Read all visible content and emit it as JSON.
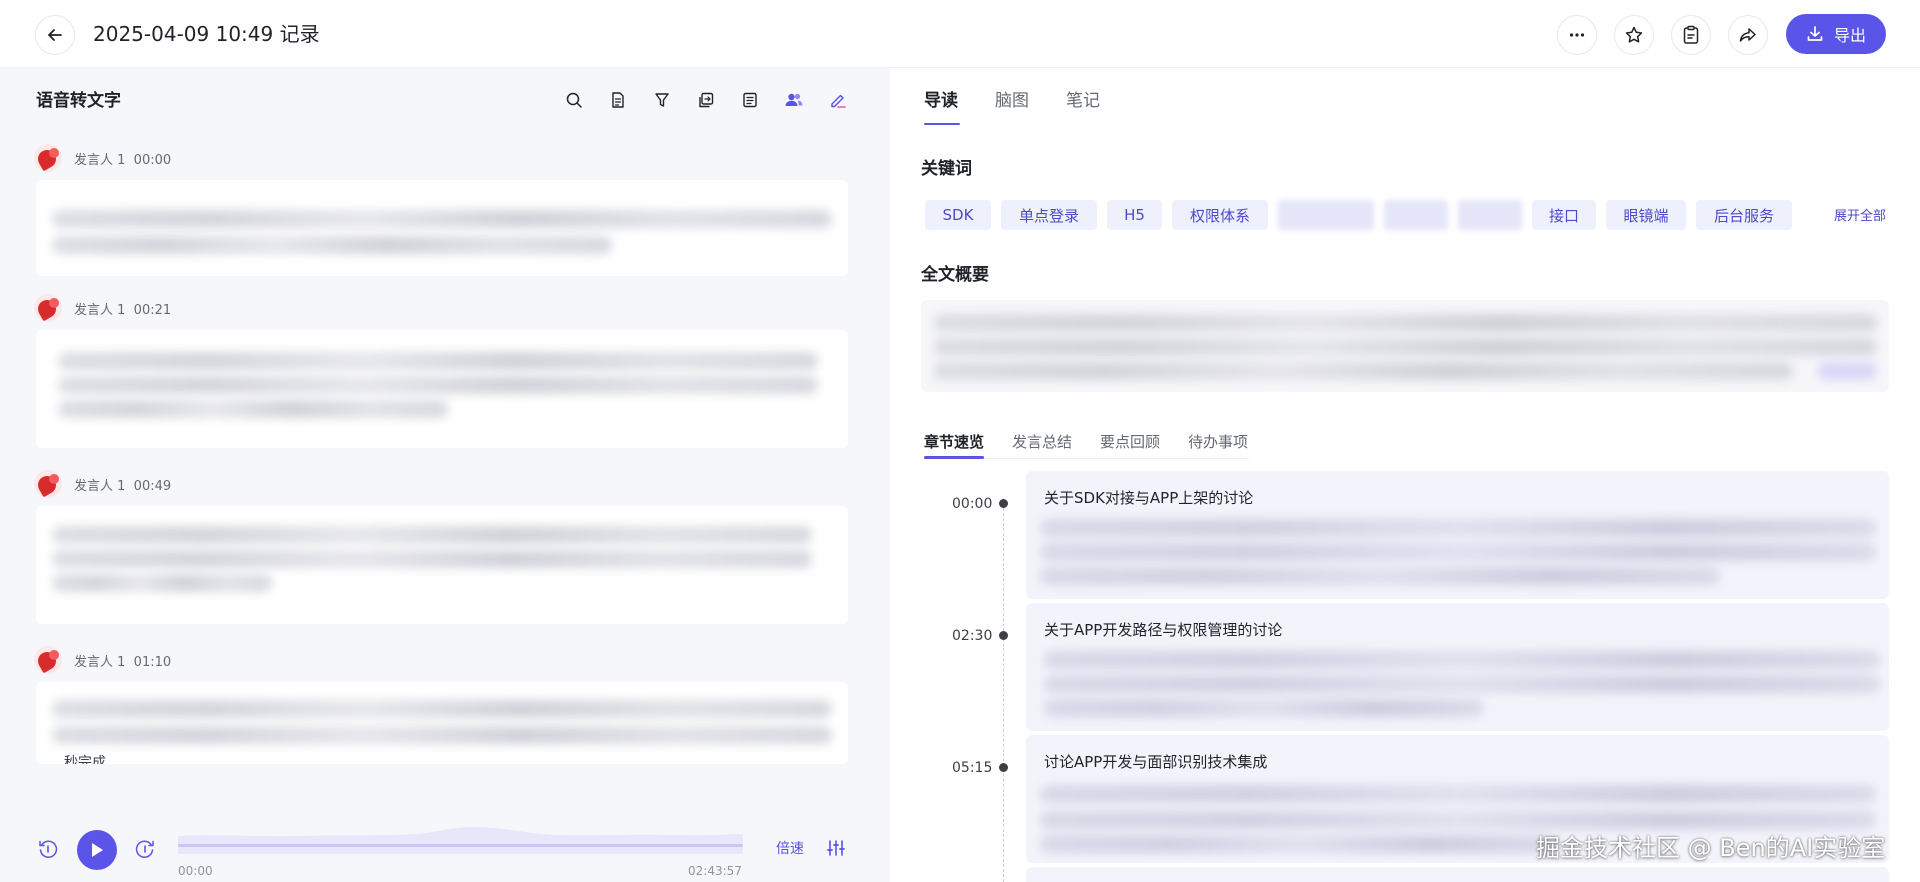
{
  "header": {
    "title": "2025-04-09 10:49 记录",
    "export_label": "导出"
  },
  "transcript": {
    "title": "语音转文字",
    "entries": [
      {
        "speaker": "发言人 1",
        "time": "00:00"
      },
      {
        "speaker": "发言人 1",
        "time": "00:21"
      },
      {
        "speaker": "发言人 1",
        "time": "00:49"
      },
      {
        "speaker": "发言人 1",
        "time": "01:10"
      }
    ],
    "partial_text": "秒完成"
  },
  "player": {
    "current_time": "00:00",
    "total_time": "02:43:57",
    "speed_label": "倍速"
  },
  "right": {
    "tabs": [
      "导读",
      "脑图",
      "笔记"
    ],
    "keywords_title": "关键词",
    "keywords": [
      "SDK",
      "单点登录",
      "H5",
      "权限体系",
      "接口",
      "眼镜端",
      "后台服务"
    ],
    "expand_all": "展开全部",
    "summary_title": "全文概要",
    "subtabs": [
      "章节速览",
      "发言总结",
      "要点回顾",
      "待办事项"
    ],
    "chapters": [
      {
        "time": "00:00",
        "title": "关于SDK对接与APP上架的讨论"
      },
      {
        "time": "02:30",
        "title": "关于APP开发路径与权限管理的讨论"
      },
      {
        "time": "05:15",
        "title": "讨论APP开发与面部识别技术集成"
      }
    ]
  },
  "watermark": "掘金技术社区 @ Ben的AI实验室",
  "colors": {
    "accent": "#5b54e8",
    "keyword_bg": "#eef0fb",
    "panel_bg": "#f6f7fb"
  }
}
